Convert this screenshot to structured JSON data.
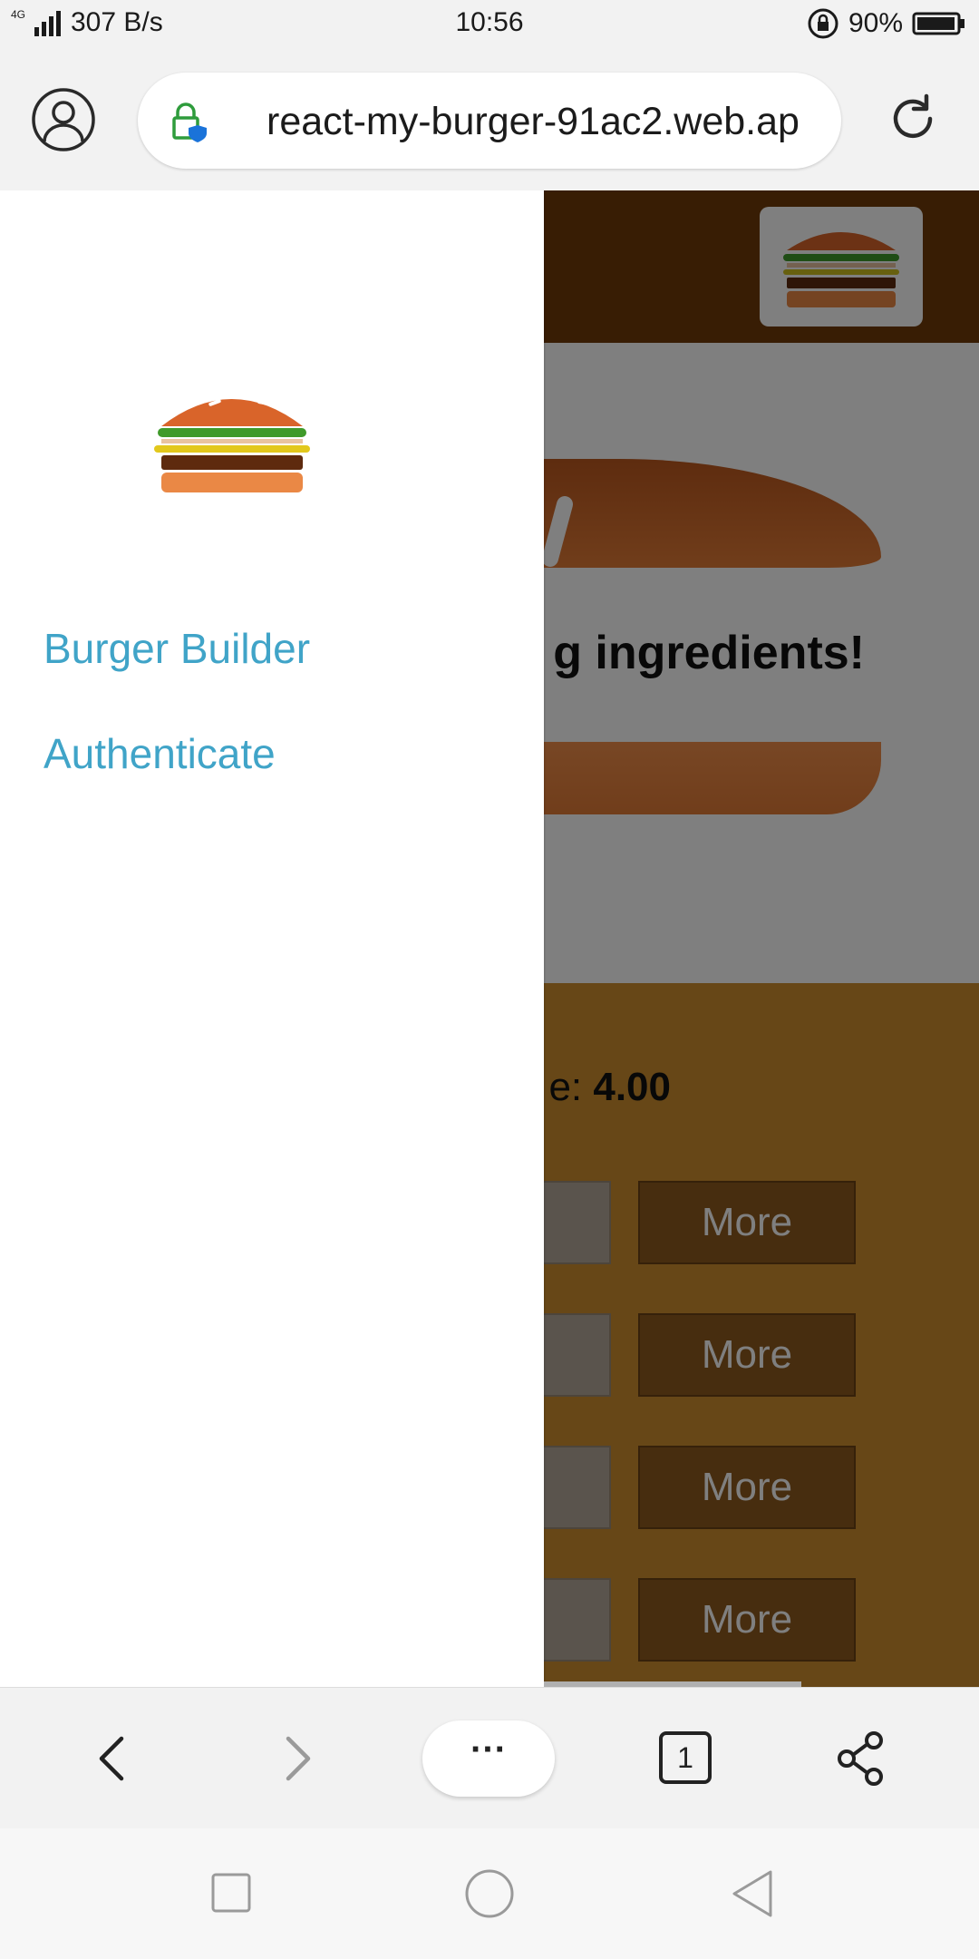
{
  "status_bar": {
    "network": "4G",
    "speed": "307 B/s",
    "time": "10:56",
    "battery": "90%"
  },
  "browser": {
    "url": "react-my-burger-91ac2.web.ap",
    "tab_count": "1",
    "menu_label": "···"
  },
  "app": {
    "message": "g ingredients!",
    "price_prefix": "e: ",
    "price_value": "4.00",
    "more_label": "More",
    "controls": [
      {
        "more": "More"
      },
      {
        "more": "More"
      },
      {
        "more": "More"
      },
      {
        "more": "More"
      }
    ]
  },
  "drawer": {
    "items": [
      {
        "label": "Burger Builder"
      },
      {
        "label": "Authenticate"
      }
    ]
  },
  "colors": {
    "toolbar": "#703b09",
    "controls_bg": "#cf8f2e",
    "nav_link": "#40a4c8",
    "bread": "#e27b36"
  },
  "icons": [
    "profile-icon",
    "lock-shield-icon",
    "reload-icon",
    "back-icon",
    "forward-icon",
    "tabs-icon",
    "share-icon",
    "burger-logo-icon",
    "recents-icon",
    "home-icon",
    "system-back-icon"
  ]
}
